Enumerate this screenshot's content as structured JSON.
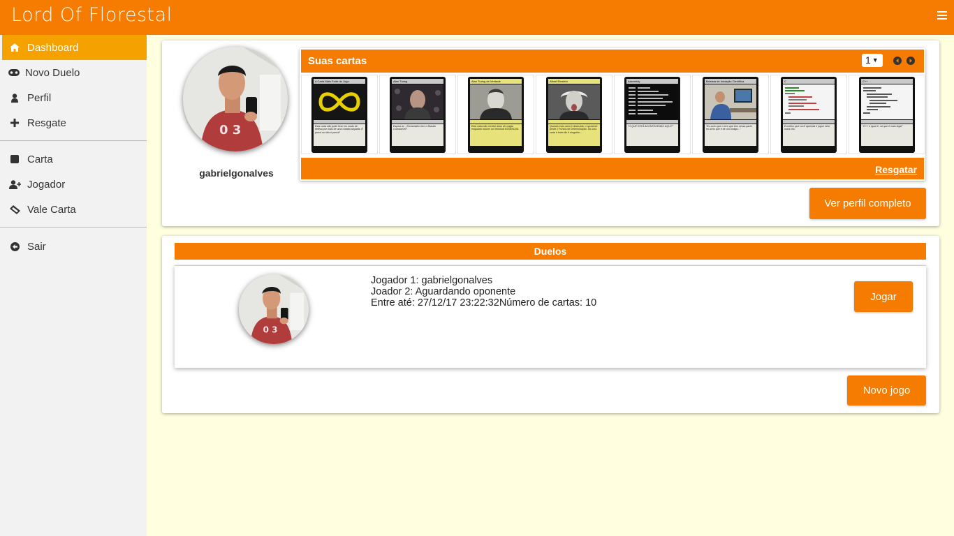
{
  "app": {
    "title": "Lord Of Florestal"
  },
  "sidebar": {
    "items": [
      {
        "label": "Dashboard",
        "icon": "home-icon"
      },
      {
        "label": "Novo Duelo",
        "icon": "gamepad-icon"
      },
      {
        "label": "Perfil",
        "icon": "user-icon"
      },
      {
        "label": "Resgate",
        "icon": "plus-icon"
      },
      {
        "label": "Carta",
        "icon": "square-icon"
      },
      {
        "label": "Jogador",
        "icon": "user-plus-icon"
      },
      {
        "label": "Vale Carta",
        "icon": "ticket-icon"
      },
      {
        "label": "Sair",
        "icon": "arrow-circle-left-icon"
      }
    ]
  },
  "profile": {
    "username": "gabrielgonalves",
    "view_profile_label": "Ver perfil completo"
  },
  "cards": {
    "title": "Suas cartas",
    "page": "1",
    "claim_label": "Resgatar",
    "items": [
      {
        "name": "A Carta Mais Forte do Jogo",
        "text": "Esta carta não pode ficar em modo de defesa por mais de uma rodada seguida. É porca ou não é porca?",
        "gold": false
      },
      {
        "name": "Alan Turing",
        "text": "Espera aí... Ela também tem o Brasão Conduzível?",
        "gold": false
      },
      {
        "name": "Alan Turing de Verdade",
        "text": "Esta carta não recebe dano de magia enquanto houver um terminal ESSENCIAL",
        "gold": true
      },
      {
        "name": "Albert Einstein",
        "text": "Quando esta carta é destruída, o oponente perde 2 Pontos de Determinação. Só uma carta é forte tão é ninguém...",
        "gold": true
      },
      {
        "name": "Assembly",
        "text": "\"O QUE ESTÁ ACONTECENDO AQUI?\"",
        "gold": false
      },
      {
        "name": "Bolsista de Iniciação Científica",
        "text": "\"Eu acho que o erro que tem nessa parte, eu acho que é de um código...\"",
        "gold": false
      },
      {
        "name": "C",
        "text": "É melhor que você aprenda e jogue nela outra vez.",
        "gold": false
      },
      {
        "name": "C++",
        "text": "\"C++ é igual C, só que é mais legal\"",
        "gold": false
      }
    ]
  },
  "duels": {
    "title": "Duelos",
    "player1": "Jogador 1: gabrielgonalves",
    "player2": "Joador 2: Aguardando oponente",
    "deadline": "Entre até: 27/12/17 23:22:32Número de cartas: 10",
    "play_label": "Jogar",
    "new_game_label": "Novo jogo"
  },
  "colors": {
    "accent": "#f57c00",
    "active": "#f5a200",
    "background": "#ffffe0"
  }
}
